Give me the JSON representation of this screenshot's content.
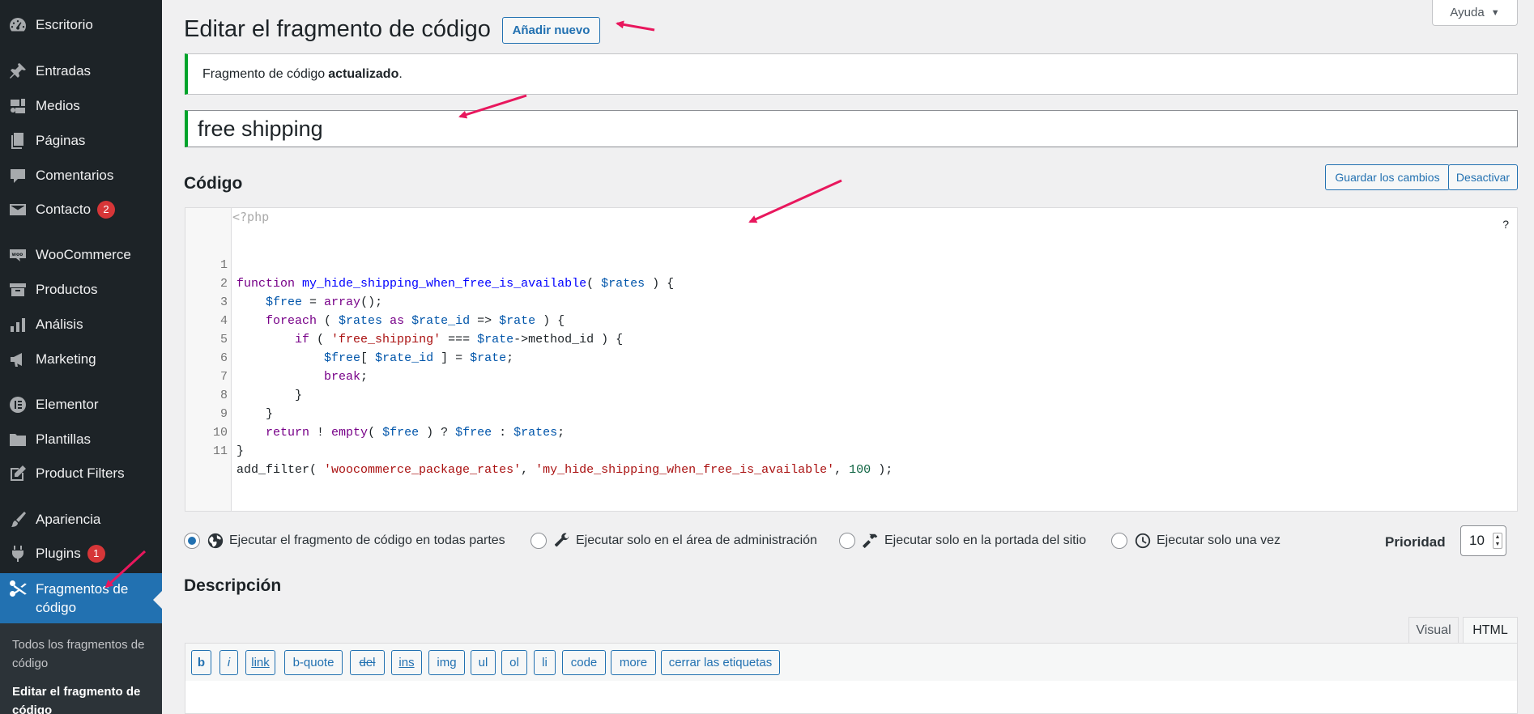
{
  "sidebar": {
    "items": [
      {
        "label": "Escritorio",
        "icon": "dashboard-icon"
      },
      {
        "label": "Entradas",
        "icon": "pin-icon"
      },
      {
        "label": "Medios",
        "icon": "media-icon"
      },
      {
        "label": "Páginas",
        "icon": "pages-icon"
      },
      {
        "label": "Comentarios",
        "icon": "comment-icon"
      },
      {
        "label": "Contacto",
        "icon": "mail-icon",
        "badge": "2"
      },
      {
        "label": "WooCommerce",
        "icon": "woo-icon"
      },
      {
        "label": "Productos",
        "icon": "archive-icon"
      },
      {
        "label": "Análisis",
        "icon": "chart-icon"
      },
      {
        "label": "Marketing",
        "icon": "megaphone-icon"
      },
      {
        "label": "Elementor",
        "icon": "elementor-icon"
      },
      {
        "label": "Plantillas",
        "icon": "folder-icon"
      },
      {
        "label": "Product Filters",
        "icon": "edit-icon"
      },
      {
        "label": "Apariencia",
        "icon": "brush-icon"
      },
      {
        "label": "Plugins",
        "icon": "plugin-icon",
        "badge": "1"
      }
    ],
    "active": {
      "label": "Fragmentos de código",
      "icon": "scissors-icon"
    },
    "submenu": [
      {
        "label": "Todos los fragmentos de código"
      },
      {
        "label": "Editar el fragmento de código"
      }
    ]
  },
  "help_tab": {
    "label": "Ayuda",
    "icon": "triangle-down-icon"
  },
  "header": {
    "title": "Editar el fragmento de código",
    "add_new": "Añadir nuevo"
  },
  "notice": {
    "text": "Fragmento de código",
    "bold": "actualizado",
    "suffix": "."
  },
  "snippet": {
    "title": "free shipping"
  },
  "code_section": {
    "heading": "Código",
    "save_label": "Guardar los cambios",
    "deactivate_label": "Desactivar"
  },
  "editor": {
    "php_open": "<?php",
    "help": "?",
    "lines": [
      {
        "n": "1"
      },
      {
        "n": "2"
      },
      {
        "n": "3"
      },
      {
        "n": "4"
      },
      {
        "n": "5"
      },
      {
        "n": "6"
      },
      {
        "n": "7"
      },
      {
        "n": "8"
      },
      {
        "n": "9"
      },
      {
        "n": "10"
      },
      {
        "n": "11"
      }
    ],
    "tokens": {
      "l1": [
        "function",
        " ",
        "my_hide_shipping_when_free_is_available",
        "( ",
        "$rates",
        " ) {"
      ],
      "l2": [
        "    ",
        "$free",
        " = ",
        "array",
        "();"
      ],
      "l3": [
        "    ",
        "foreach",
        " ( ",
        "$rates",
        " ",
        "as",
        " ",
        "$rate_id",
        " => ",
        "$rate",
        " ) {"
      ],
      "l4": [
        "        ",
        "if",
        " ( ",
        "'free_shipping'",
        " === ",
        "$rate",
        "->method_id ) {"
      ],
      "l5": [
        "            ",
        "$free",
        "[ ",
        "$rate_id",
        " ] = ",
        "$rate",
        ";"
      ],
      "l6": [
        "            ",
        "break",
        ";"
      ],
      "l7": [
        "        }"
      ],
      "l8": [
        "    }"
      ],
      "l9": [
        "    ",
        "return",
        " ! ",
        "empty",
        "( ",
        "$free",
        " ) ? ",
        "$free",
        " : ",
        "$rates",
        ";"
      ],
      "l10": [
        "}"
      ],
      "l11": [
        "add_filter( ",
        "'woocommerce_package_rates'",
        ", ",
        "'my_hide_shipping_when_free_is_available'",
        ", ",
        "100",
        " );"
      ]
    }
  },
  "run_options": [
    {
      "label": "Ejecutar el fragmento de código en todas partes",
      "icon": "globe-icon",
      "checked": true
    },
    {
      "label": "Ejecutar solo en el área de administración",
      "icon": "wrench-icon",
      "checked": false
    },
    {
      "label": "Ejecutar solo en la portada del sitio",
      "icon": "hammer-icon",
      "checked": false
    },
    {
      "label": "Ejecutar solo una vez",
      "icon": "clock-icon",
      "checked": false
    }
  ],
  "priority": {
    "label": "Prioridad",
    "value": "10"
  },
  "description": {
    "heading": "Descripción",
    "tabs": {
      "visual": "Visual",
      "html": "HTML"
    },
    "quicktags": [
      "b",
      "i",
      "link",
      "b-quote",
      "del",
      "ins",
      "img",
      "ul",
      "ol",
      "li",
      "code",
      "more",
      "cerrar las etiquetas"
    ]
  },
  "colors": {
    "sidebar_bg": "#1d2327",
    "active_bg": "#2271b1",
    "accent": "#2271b1",
    "success": "#00a32a",
    "badge": "#d63638",
    "arrow": "#e8175d"
  }
}
